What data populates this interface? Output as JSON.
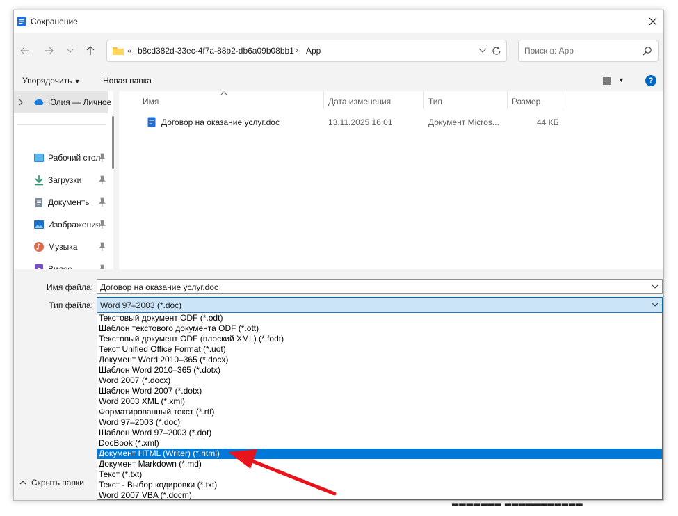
{
  "window": {
    "title": "Сохранение",
    "close_glyph": "✕"
  },
  "navigation": {
    "address_chevron": "«",
    "address_path": "b8cd382d-33ec-4f7a-88b2-db6a09b08bb1",
    "address_separator": "›",
    "address_current": "App",
    "search_placeholder": "Поиск в: App"
  },
  "toolbar": {
    "organize_label": "Упорядочить",
    "new_folder_label": "Новая папка",
    "help_glyph": "?"
  },
  "sidebar": {
    "top_item": "Юлия — Личное",
    "items": [
      {
        "label": "Рабочий стол",
        "icon": "desktop-icon"
      },
      {
        "label": "Загрузки",
        "icon": "download-icon"
      },
      {
        "label": "Документы",
        "icon": "documents-icon"
      },
      {
        "label": "Изображения",
        "icon": "pictures-icon"
      },
      {
        "label": "Музыка",
        "icon": "music-icon"
      },
      {
        "label": "Видео",
        "icon": "video-icon"
      }
    ]
  },
  "files": {
    "columns": {
      "name": "Имя",
      "date": "Дата изменения",
      "type": "Тип",
      "size": "Размер"
    },
    "rows": [
      {
        "name": "Договор на оказание услуг.doc",
        "date": "13.11.2025 16:01",
        "type": "Документ Micros...",
        "size": "44 КБ"
      }
    ]
  },
  "form": {
    "filename_label": "Имя файла:",
    "filename_value": "Договор на оказание услуг.doc",
    "filetype_label": "Тип файла:",
    "filetype_value": "Word 97–2003 (*.doc)",
    "hide_folders_label": "Скрыть папки"
  },
  "dropdown": {
    "options": [
      "Текстовый документ ODF (*.odt)",
      "Шаблон текстового документа ODF (*.ott)",
      "Текстовый документ ODF (плоский XML) (*.fodt)",
      "Текст Unified Office Format (*.uot)",
      "Документ Word 2010–365 (*.docx)",
      "Шаблон Word 2010–365 (*.dotx)",
      "Word 2007 (*.docx)",
      "Шаблон Word 2007 (*.dotx)",
      "Word 2003 XML (*.xml)",
      "Форматированный текст (*.rtf)",
      "Word 97–2003 (*.doc)",
      "Шаблон Word 97–2003 (*.dot)",
      "DocBook (*.xml)",
      "Документ HTML (Writer) (*.html)",
      "Документ Markdown (*.md)",
      "Текст (*.txt)",
      "Текст - Выбор кодировки (*.txt)",
      "Word 2007 VBA (*.docm)"
    ],
    "selected_index": 13
  },
  "colors": {
    "accent": "#0067c0",
    "selection": "#0078d7",
    "arrow": "#e8141b"
  }
}
